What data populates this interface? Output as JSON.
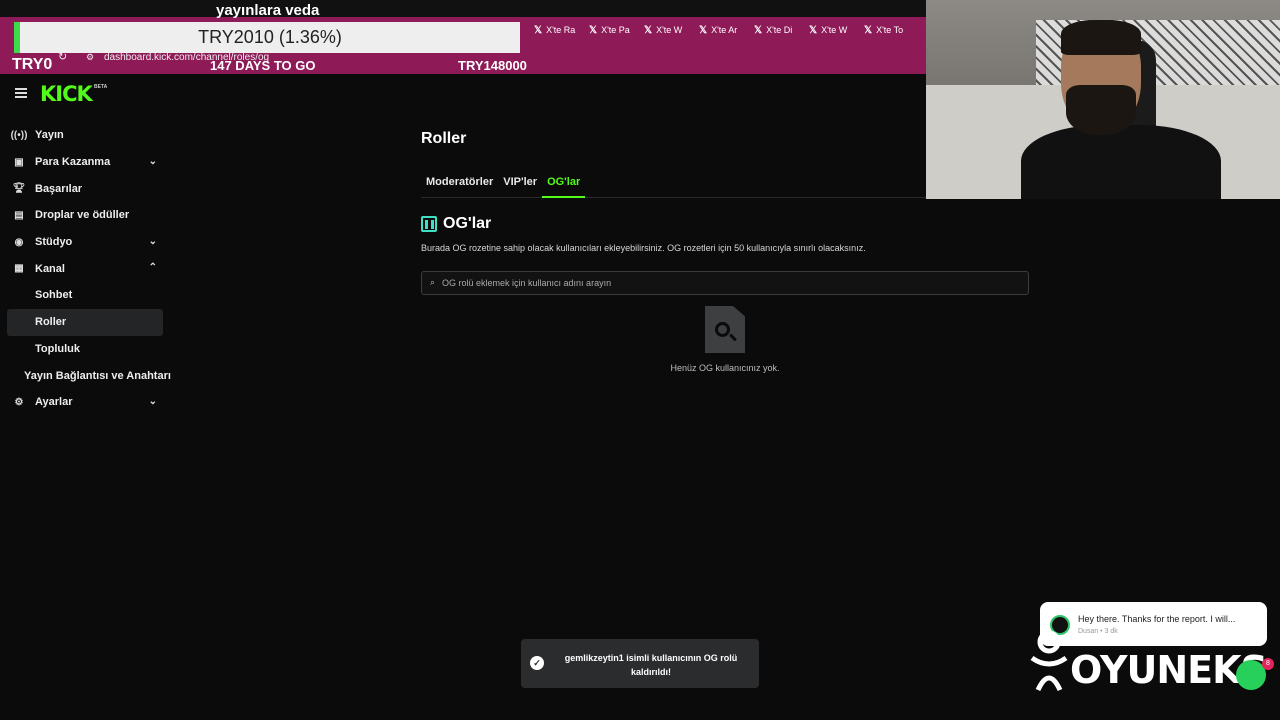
{
  "overlay": {
    "banner_text": "yayınlara veda",
    "goal_current": "TRY2010 (1.36%)",
    "goal_left": "TRY0",
    "goal_days": "147 DAYS TO GO",
    "goal_target": "TRY148000",
    "goal_fill_percent": 1.36
  },
  "browser": {
    "url": "dashboard.kick.com/channel/roles/og",
    "tabs": [
      {
        "label": "X'te Ra"
      },
      {
        "label": "X'te Pa"
      },
      {
        "label": "X'te W"
      },
      {
        "label": "X'te Ar"
      },
      {
        "label": "X'te Di"
      },
      {
        "label": "X'te W"
      },
      {
        "label": "X'te To"
      }
    ]
  },
  "sidebar": {
    "logo": "KICK",
    "logo_badge": "BETA",
    "items": [
      {
        "label": "Yayın",
        "icon": "broadcast-icon"
      },
      {
        "label": "Para Kazanma",
        "icon": "wallet-icon"
      },
      {
        "label": "Başarılar",
        "icon": "trophy-icon"
      },
      {
        "label": "Droplar ve ödüller",
        "icon": "gift-icon"
      },
      {
        "label": "Stüdyo",
        "icon": "studio-icon"
      },
      {
        "label": "Kanal",
        "icon": "channel-icon"
      },
      {
        "label": "Sohbet"
      },
      {
        "label": "Roller"
      },
      {
        "label": "Topluluk"
      },
      {
        "label": "Yayın Bağlantısı ve Anahtarı"
      },
      {
        "label": "Ayarlar",
        "icon": "gear-icon"
      }
    ]
  },
  "main": {
    "title": "Roller",
    "tabs": [
      {
        "label": "Moderatörler"
      },
      {
        "label": "VIP'ler"
      },
      {
        "label": "OG'lar"
      }
    ],
    "section_title": "OG'lar",
    "section_desc": "Burada OG rozetine sahip olacak kullanıcıları ekleyebilirsiniz. OG rozetleri için 50 kullanıcıyla sınırlı olacaksınız.",
    "search_placeholder": "OG rolü eklemek için kullanıcı adını arayın",
    "empty_text": "Henüz OG kullanıcınız yok."
  },
  "chat_notification": {
    "message": "Hey there. Thanks for the report. I will...",
    "meta": "Dusan • 3 dk",
    "unread": "8"
  },
  "brand": {
    "name": "OYUNEKS"
  },
  "toast": {
    "text": "gemlikzeytin1 isimli kullanıcının OG rolü kaldırıldı!"
  },
  "colors": {
    "accent": "#53fc18",
    "strip": "#8e1b57",
    "background": "#0b0b0c"
  }
}
